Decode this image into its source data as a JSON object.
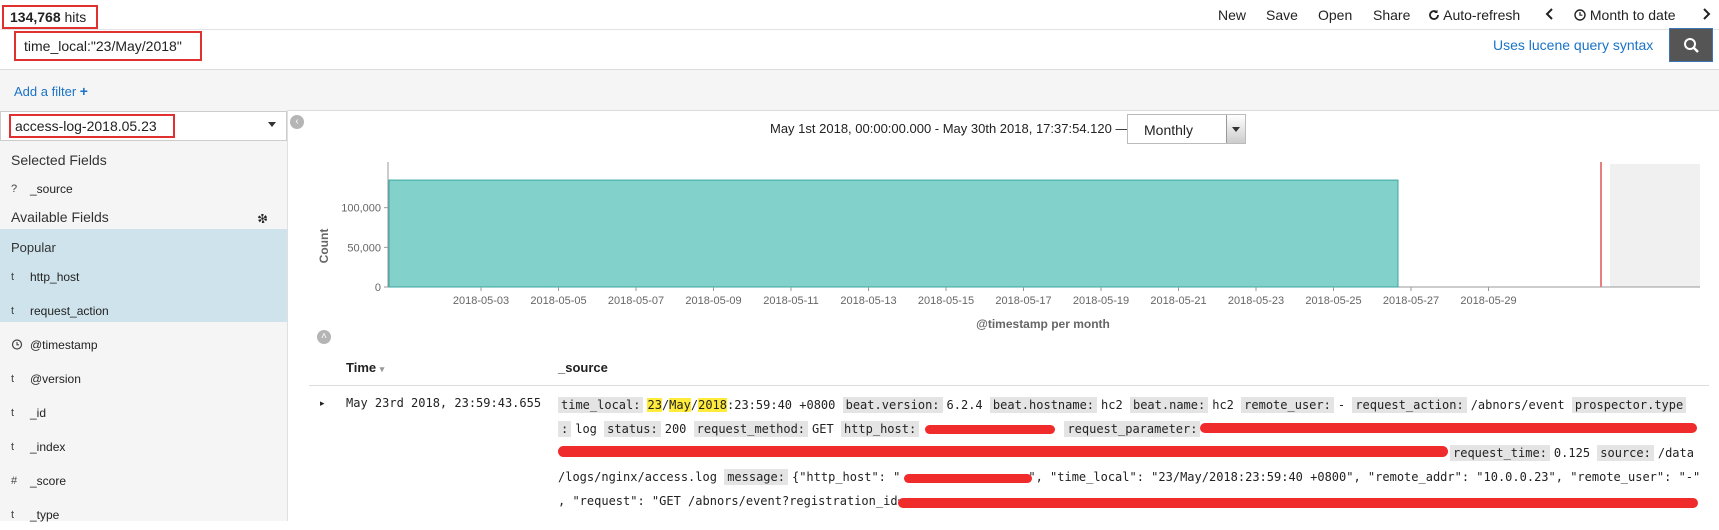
{
  "header": {
    "hits_count": "134,768",
    "hits_label": "hits",
    "menu": [
      "New",
      "Save",
      "Open",
      "Share"
    ],
    "auto_refresh": "Auto-refresh",
    "time_range": "Month to date"
  },
  "query": {
    "value": "time_local:\"23/May/2018\"",
    "syntax_link": "Uses lucene query syntax"
  },
  "filter": {
    "add_label": "Add a filter"
  },
  "sidebar": {
    "index_pattern": "access-log-2018.05.23",
    "selected_heading": "Selected Fields",
    "selected_fields": [
      {
        "type": "?",
        "name": "_source"
      }
    ],
    "available_heading": "Available Fields",
    "popular_heading": "Popular",
    "popular_fields": [
      {
        "type": "t",
        "name": "http_host"
      },
      {
        "type": "t",
        "name": "request_action"
      }
    ],
    "fields": [
      {
        "type": "clock",
        "name": "@timestamp"
      },
      {
        "type": "t",
        "name": "@version"
      },
      {
        "type": "t",
        "name": "_id"
      },
      {
        "type": "t",
        "name": "_index"
      },
      {
        "type": "#",
        "name": "_score"
      },
      {
        "type": "t",
        "name": "_type"
      }
    ]
  },
  "histogram": {
    "range_text": "May 1st 2018, 00:00:00.000 - May 30th 2018, 17:37:54.120 —",
    "interval": "Monthly"
  },
  "chart_data": {
    "type": "bar",
    "categories": [
      "2018-05-01 to 2018-05-26"
    ],
    "values": [
      134768
    ],
    "xlabel": "@timestamp per month",
    "ylabel": "Count",
    "ylim": [
      0,
      150000
    ],
    "y_ticks": [
      "0",
      "50,000",
      "100,000"
    ],
    "x_ticks": [
      "2018-05-03",
      "2018-05-05",
      "2018-05-07",
      "2018-05-09",
      "2018-05-11",
      "2018-05-13",
      "2018-05-15",
      "2018-05-17",
      "2018-05-19",
      "2018-05-21",
      "2018-05-23",
      "2018-05-25",
      "2018-05-27",
      "2018-05-29"
    ],
    "bar_color": "#82d1cb",
    "now_marker_color": "#e87e7e"
  },
  "table": {
    "col_time": "Time",
    "col_source": "_source",
    "row_time": "May 23rd 2018, 23:59:43.655",
    "l1": {
      "k_time_local": "time_local:",
      "hl_day": "23",
      "sep1": "/",
      "hl_month": "May",
      "sep2": "/",
      "hl_year": "2018",
      "time_rest": ":23:59:40 +0800",
      "k_bv": "beat.version:",
      "v_bv": "6.2.4",
      "k_bh": "beat.hostname:",
      "v_bh": "hc2",
      "k_bn": "beat.name:",
      "v_bn": "hc2",
      "k_ru": "remote_user:",
      "v_ru": "-",
      "k_ra": "request_action:",
      "v_ra": "/abnors/event",
      "k_pt": "prospector.type"
    },
    "l2": {
      "k_pt2": ":",
      "v_pt": "log",
      "k_st": "status:",
      "v_st": "200",
      "k_rm": "request_method:",
      "v_rm": "GET",
      "k_hh": "http_host:",
      "k_rp": "request_parameter:"
    },
    "l3": {
      "k_rt": "request_time:",
      "v_rt": "0.125",
      "k_src": "source:",
      "v_src": "/data"
    },
    "l4": {
      "v_src2": "/logs/nginx/access.log",
      "k_msg": "message:",
      "v_msg_a": "{\"http_host\": \"",
      "v_msg_b": "\", \"time_local\": \"23/May/2018:23:59:40 +0800\", \"remote_addr\": \"10.0.0.23\", \"remote_user\": \"-\""
    },
    "l5": {
      "v": ", \"request\": \"GET /abnors/event?registration_id="
    }
  }
}
